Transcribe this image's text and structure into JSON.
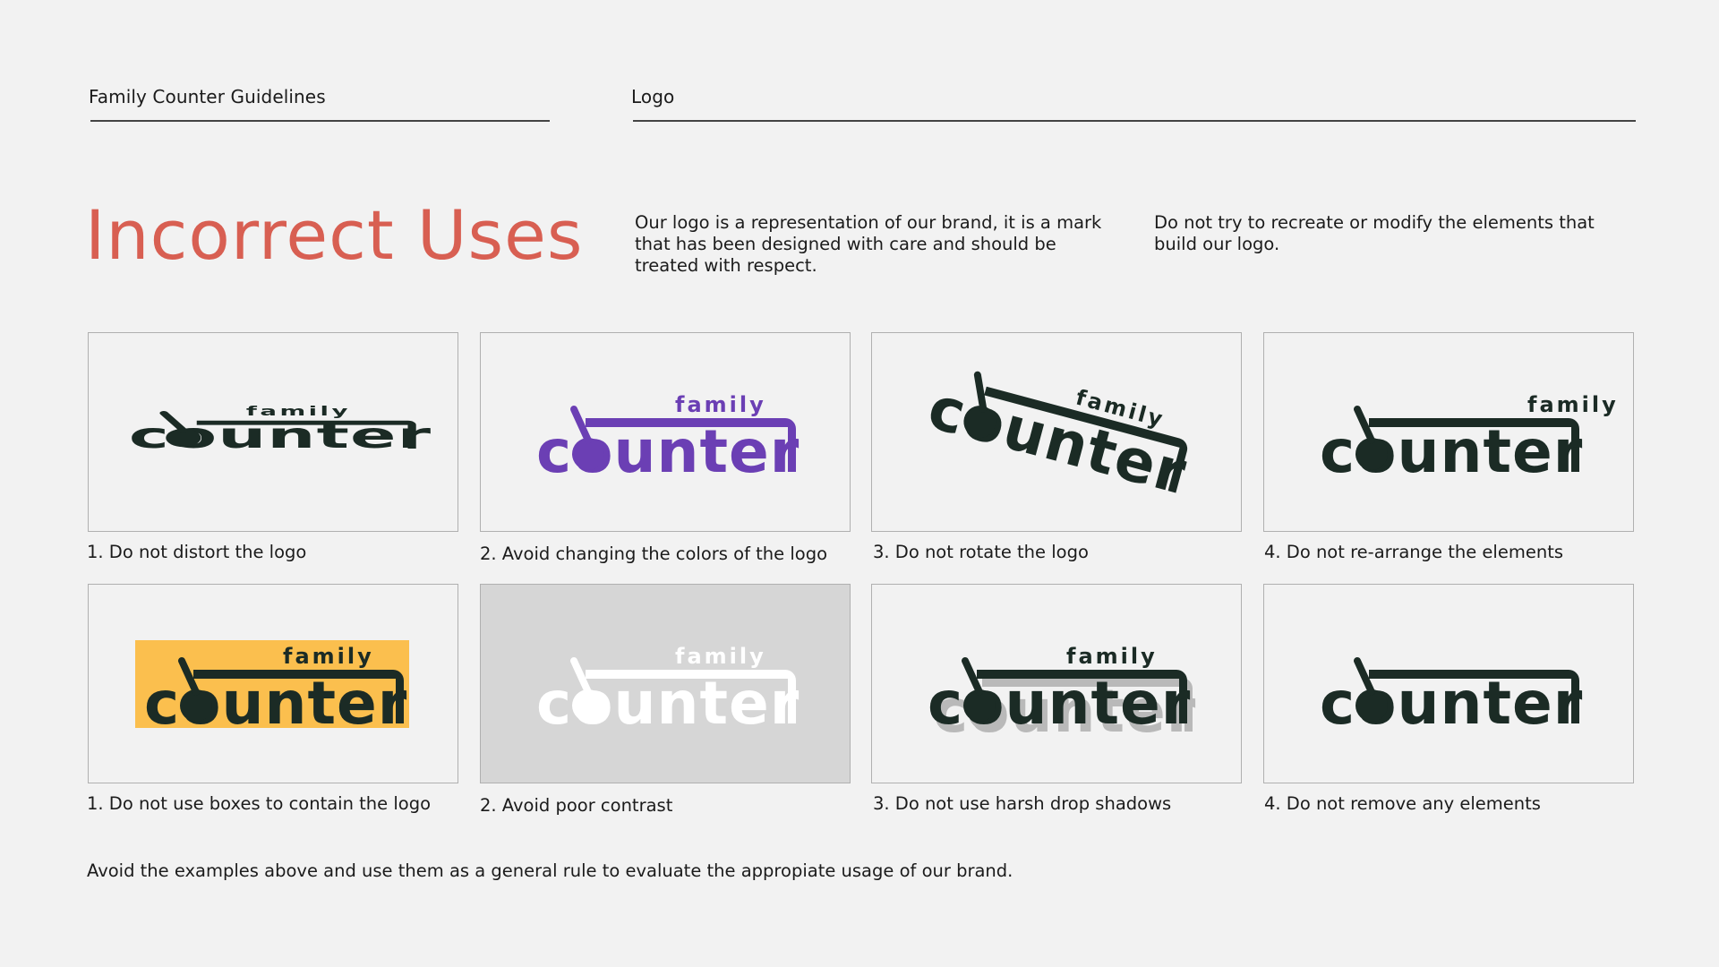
{
  "header": {
    "section_label": "Family Counter Guidelines",
    "page_label": "Logo"
  },
  "title": "Incorrect Uses",
  "intro": {
    "paragraph_1": "Our logo is a representation of our brand, it is a mark that has been designed with care and should be treated with respect.",
    "paragraph_2": "Do not try to recreate or modify the elements that build our logo."
  },
  "logo": {
    "word_top": "family",
    "word_main": "counter"
  },
  "colors": {
    "title": "#d85f52",
    "logo": "#1b2b25",
    "logo_purple": "#6b3fb4",
    "box_yellow": "#fbbf4e",
    "gray_background": "#d6d6d6"
  },
  "examples_row_1": [
    {
      "caption": "1. Do not distort the logo"
    },
    {
      "caption": "2. Avoid changing the colors of the logo"
    },
    {
      "caption": "3. Do not rotate the logo"
    },
    {
      "caption": "4. Do not re-arrange the elements"
    }
  ],
  "examples_row_2": [
    {
      "caption": "1. Do not use boxes to contain the logo"
    },
    {
      "caption": "2. Avoid poor contrast"
    },
    {
      "caption": "3. Do not use harsh drop shadows"
    },
    {
      "caption": "4. Do not remove any elements"
    }
  ],
  "footer_note": "Avoid the examples above and use them as a general rule to evaluate the appropiate usage of our brand."
}
